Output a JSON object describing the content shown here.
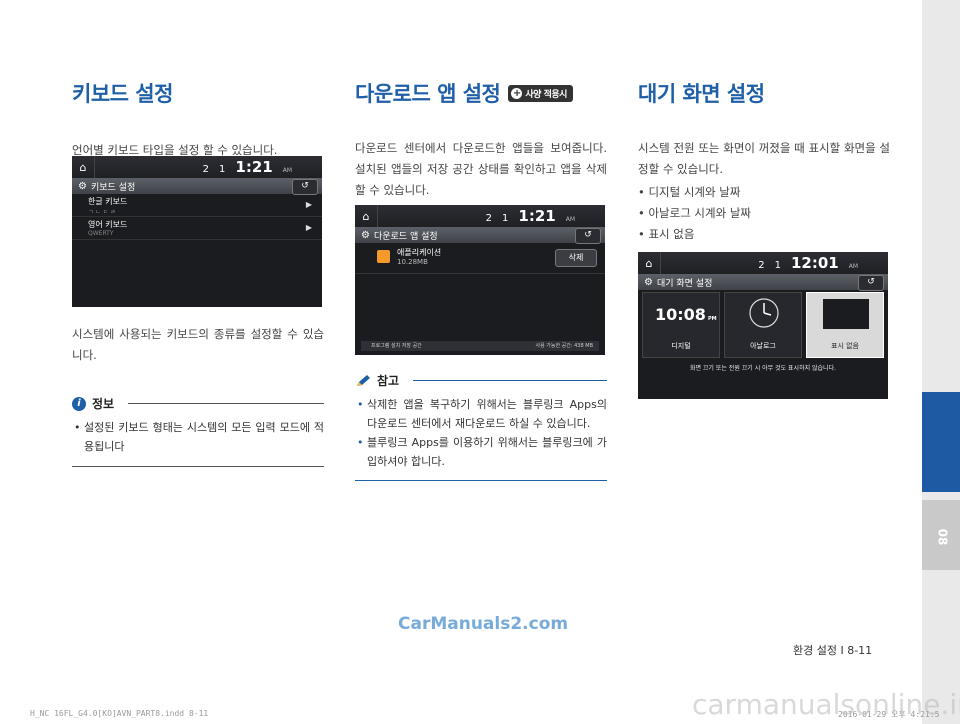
{
  "col1": {
    "title": "키보드 설정",
    "intro": "언어별 키보드 타입을 설정 할 수 있습니다.",
    "screen": {
      "status_2": "2",
      "status_1": "1",
      "clock": "1:21",
      "ampm": "AM",
      "title": "키보드 설정",
      "rows": [
        {
          "label": "한글 키보드",
          "sub": "ㄱ ㄴ ㄷ ㄹ"
        },
        {
          "label": "영어 키보드",
          "sub": "QWERTY"
        }
      ]
    },
    "desc": "시스템에 사용되는 키보드의 종류를 설정할 수 있습니다.",
    "info_heading": "정보",
    "info_items": [
      "설정된 키보드 형태는 시스템의 모든 입력 모드에 적용됩니다"
    ]
  },
  "col2": {
    "title": "다운로드 앱 설정",
    "badge": "사양 적용시",
    "intro": "다운로드 센터에서 다운로드한 앱들을 보여줍니다. 설치된 앱들의 저장 공간 상태를 확인하고 앱을 삭제할 수 있습니다.",
    "screen": {
      "status_2": "2",
      "status_1": "1",
      "clock": "1:21",
      "ampm": "AM",
      "title": "다운로드 앱 설정",
      "app_name": "애플리케이션",
      "app_size": "10.28MB",
      "delete_label": "삭제",
      "storage_left": "프로그램 설치 저장 공간",
      "storage_right": "사용 가능한 공간: 438 MB"
    },
    "note_heading": "참고",
    "note_items": [
      "삭제한 앱을 복구하기 위해서는 블루링크 Apps의 다운로드 센터에서 재다운로드 하실 수 있습니다.",
      "블루링크 Apps를 이용하기 위해서는 블루링크에 가입하셔야 합니다."
    ]
  },
  "col3": {
    "title": "대기 화면 설정",
    "intro": "시스템 전원 또는 화면이 꺼졌을 때 표시할 화면을 설정할 수 있습니다.",
    "items": [
      "디지털 시계와 날짜",
      "아날로그 시계와 날짜",
      "표시 없음"
    ],
    "screen": {
      "status_2": "2",
      "status_1": "1",
      "clock": "12:01",
      "ampm": "AM",
      "title": "대기 화면 설정",
      "digital_time": "10:08",
      "digital_ampm": "PM",
      "options": [
        "디지털",
        "아날로그",
        "표시 없음"
      ],
      "message": "화면 끄기 또는 전원 끄기 시 아무 것도 표시하지 않습니다."
    }
  },
  "sidebar": {
    "chapter": "08"
  },
  "footer": {
    "page": "환경 설정 I 8-11",
    "file": "H_NC 16FL_G4.0[KO]AVN_PART8.indd   8-11",
    "date": "2016-01-29  오후 4:21:5"
  },
  "watermarks": {
    "left": "CarManuals2.com",
    "right": "carmanualsonline.info"
  },
  "colors": {
    "accent": "#1f5fa8",
    "sidebar_blue": "#1d5aa3",
    "screen_bg": "#1b1c20"
  }
}
